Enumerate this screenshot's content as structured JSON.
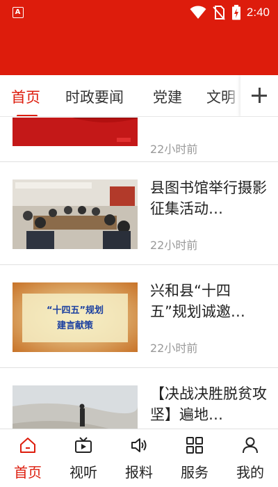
{
  "status_bar": {
    "app_badge": "A",
    "time": "2:40"
  },
  "tabs": [
    {
      "label": "首页",
      "active": true
    },
    {
      "label": "时政要闻",
      "active": false
    },
    {
      "label": "党建",
      "active": false
    },
    {
      "label": "文明",
      "active": false
    }
  ],
  "news": [
    {
      "title": "",
      "time": "22小时前",
      "thumb": "red-stage-image"
    },
    {
      "title": "县图书馆举行摄影征集活动…",
      "time": "22小时前",
      "thumb": "meeting-room-image"
    },
    {
      "title": "兴和县“十四五”规划诚邀…",
      "time": "22小时前",
      "thumb": "plan-banner-image",
      "thumb_text_top": "“十四五”规划",
      "thumb_text_bottom": "建言献策"
    },
    {
      "title": "【决战决胜脱贫攻坚】遍地…",
      "time": "",
      "thumb": "landscape-image"
    }
  ],
  "bottom_nav": [
    {
      "label": "首页",
      "icon": "home-icon",
      "active": true
    },
    {
      "label": "视听",
      "icon": "tv-icon",
      "active": false
    },
    {
      "label": "报料",
      "icon": "speaker-icon",
      "active": false
    },
    {
      "label": "服务",
      "icon": "grid-icon",
      "active": false
    },
    {
      "label": "我的",
      "icon": "user-icon",
      "active": false
    }
  ],
  "colors": {
    "brand_red": "#dd1c0c",
    "text_primary": "#222222",
    "text_secondary": "#999999"
  }
}
